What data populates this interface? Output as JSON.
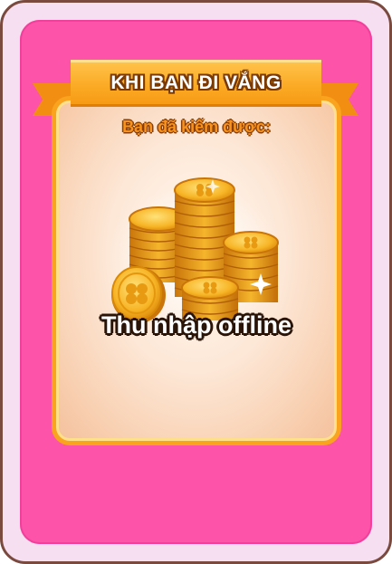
{
  "popup": {
    "title": "KHI BẠN ĐI VẮNG",
    "subtitle": "Bạn đã kiếm được:",
    "reward_label": "Thu nhập offline",
    "reward_icon": "gold-coin-stack-icon"
  },
  "colors": {
    "card_border": "#7a4a3e",
    "card_fill": "#fd53a9",
    "ribbon": "#fbab26",
    "panel_border": "#f9a31e",
    "coin_gold": "#f7b21f"
  }
}
